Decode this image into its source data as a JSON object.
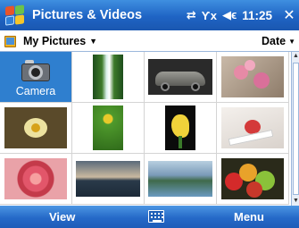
{
  "titlebar": {
    "title": "Pictures & Videos",
    "time": "11:25",
    "icons": [
      "windows-start-icon",
      "connectivity-icon",
      "signal-off-icon",
      "volume-icon",
      "close-icon"
    ]
  },
  "folderbar": {
    "folder": "My Pictures",
    "sort": "Date"
  },
  "grid": {
    "camera_label": "Camera",
    "items": [
      {
        "name": "camera-tile"
      },
      {
        "name": "thumb-waterfall"
      },
      {
        "name": "thumb-car"
      },
      {
        "name": "thumb-pink-flowers"
      },
      {
        "name": "thumb-yellow-flower"
      },
      {
        "name": "thumb-green-plant"
      },
      {
        "name": "thumb-calla-lily"
      },
      {
        "name": "thumb-red-flower-card"
      },
      {
        "name": "thumb-rose"
      },
      {
        "name": "thumb-lake-sunset"
      },
      {
        "name": "thumb-mountain-lake"
      },
      {
        "name": "thumb-fruit"
      }
    ]
  },
  "menubar": {
    "left": "View",
    "right": "Menu"
  },
  "colors": {
    "titlebar": "#1f64c4",
    "camera_tile": "#2f7fcf",
    "menubar": "#2569c8"
  }
}
